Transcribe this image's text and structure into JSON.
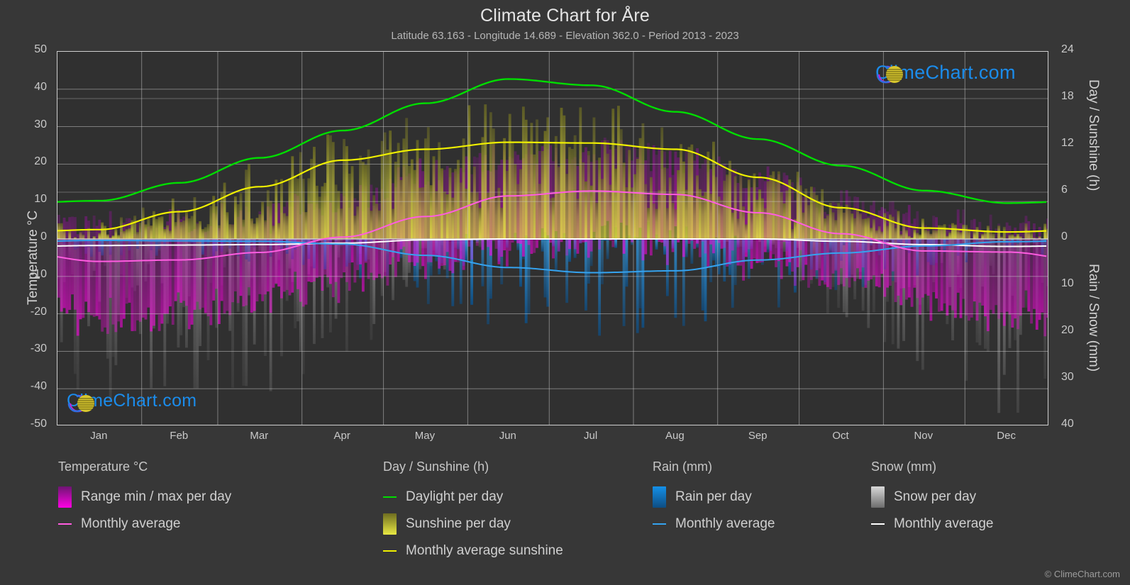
{
  "header": {
    "title": "Climate Chart for Åre",
    "subtitle": "Latitude 63.163 - Longitude 14.689 - Elevation 362.0 - Period 2013 - 2023"
  },
  "watermark": {
    "text": "ClimeChart.com"
  },
  "footer": {
    "copyright": "© ClimeChart.com"
  },
  "legend": {
    "groups": [
      {
        "title": "Temperature °C",
        "items": [
          {
            "label": "Range min / max per day",
            "swatch": "gradient",
            "color": "#ff00e4"
          },
          {
            "label": "Monthly average",
            "swatch": "line",
            "color": "#ff5ce0"
          }
        ]
      },
      {
        "title": "Day / Sunshine (h)",
        "items": [
          {
            "label": "Daylight per day",
            "swatch": "line",
            "color": "#00dd00"
          },
          {
            "label": "Sunshine per day",
            "swatch": "gradient",
            "color": "#e8e843"
          },
          {
            "label": "Monthly average sunshine",
            "swatch": "line",
            "color": "#f0f000"
          }
        ]
      },
      {
        "title": "Rain (mm)",
        "items": [
          {
            "label": "Rain per day",
            "swatch": "gradient",
            "color": "#1490e8"
          },
          {
            "label": "Monthly average",
            "swatch": "line",
            "color": "#35a3ef"
          }
        ]
      },
      {
        "title": "Snow (mm)",
        "items": [
          {
            "label": "Snow per day",
            "swatch": "gradient",
            "color": "#d8d8d8"
          },
          {
            "label": "Monthly average",
            "swatch": "line",
            "color": "#ffffff"
          }
        ]
      }
    ]
  },
  "chart_data": {
    "type": "line",
    "title": "Climate Chart for Åre",
    "subtitle": "Latitude 63.163 - Longitude 14.689 - Elevation 362.0 - Period 2013 - 2023",
    "xlabel": "",
    "grid": true,
    "legend_position": "below",
    "x_tick_labels": [
      "Jan",
      "Feb",
      "Mar",
      "Apr",
      "May",
      "Jun",
      "Jul",
      "Aug",
      "Sep",
      "Oct",
      "Nov",
      "Dec"
    ],
    "axes": {
      "left": {
        "label": "Temperature °C",
        "ylim": [
          -50,
          50
        ],
        "ticks": [
          50,
          40,
          30,
          20,
          10,
          0,
          -10,
          -20,
          -30,
          -40,
          -50
        ]
      },
      "right_top": {
        "label": "Day / Sunshine (h)",
        "ylim": [
          0,
          24
        ],
        "ticks": [
          24,
          18,
          12,
          6,
          0
        ],
        "note": "maps to temperature 0..50 above the zero line"
      },
      "right_bottom": {
        "label": "Rain / Snow (mm)",
        "ylim": [
          0,
          40
        ],
        "ticks": [
          0,
          10,
          20,
          30,
          40
        ],
        "note": "maps to temperature 0..-50 below the zero line"
      }
    },
    "series": [
      {
        "name": "Daylight per day",
        "unit": "h",
        "color": "#00dd00",
        "axis": "right_top",
        "categories": [
          "Jan",
          "Feb",
          "Mar",
          "Apr",
          "May",
          "Jun",
          "Jul",
          "Aug",
          "Sep",
          "Oct",
          "Nov",
          "Dec"
        ],
        "values": [
          4.9,
          7.2,
          10.4,
          13.9,
          17.4,
          20.5,
          19.7,
          16.3,
          12.8,
          9.4,
          6.2,
          4.6
        ]
      },
      {
        "name": "Monthly average sunshine",
        "unit": "h",
        "color": "#f0f000",
        "axis": "right_top",
        "categories": [
          "Jan",
          "Feb",
          "Mar",
          "Apr",
          "May",
          "Jun",
          "Jul",
          "Aug",
          "Sep",
          "Oct",
          "Nov",
          "Dec"
        ],
        "values": [
          1.2,
          3.5,
          6.7,
          10.1,
          11.5,
          12.4,
          12.3,
          11.5,
          7.9,
          4.0,
          1.4,
          0.9
        ]
      },
      {
        "name": "Temperature monthly average",
        "unit": "°C",
        "color": "#ff5ce0",
        "axis": "left",
        "categories": [
          "Jan",
          "Feb",
          "Mar",
          "Apr",
          "May",
          "Jun",
          "Jul",
          "Aug",
          "Sep",
          "Oct",
          "Nov",
          "Dec"
        ],
        "values": [
          -6.0,
          -5.6,
          -3.6,
          0.5,
          6.0,
          11.5,
          12.8,
          11.9,
          7.0,
          1.4,
          -3.2,
          -3.5
        ]
      },
      {
        "name": "Rain monthly average",
        "unit": "mm",
        "color": "#35a3ef",
        "axis": "right_bottom",
        "categories": [
          "Jan",
          "Feb",
          "Mar",
          "Apr",
          "May",
          "Jun",
          "Jul",
          "Aug",
          "Sep",
          "Oct",
          "Nov",
          "Dec"
        ],
        "values": [
          0.3,
          0.4,
          0.5,
          1.1,
          3.5,
          6.1,
          7.2,
          6.8,
          4.5,
          3.0,
          1.5,
          0.6
        ]
      },
      {
        "name": "Snow monthly average",
        "unit": "mm",
        "color": "#ffffff",
        "axis": "right_bottom",
        "categories": [
          "Jan",
          "Feb",
          "Mar",
          "Apr",
          "May",
          "Jun",
          "Jul",
          "Aug",
          "Sep",
          "Oct",
          "Nov",
          "Dec"
        ],
        "values": [
          1.4,
          1.3,
          1.2,
          0.9,
          0.2,
          0.0,
          0.0,
          0.0,
          0.0,
          0.5,
          1.2,
          1.6
        ]
      },
      {
        "name": "Temperature range min / max per day",
        "unit": "°C",
        "color": "#ff00e4",
        "axis": "left",
        "categories": [
          "Jan",
          "Feb",
          "Mar",
          "Apr",
          "May",
          "Jun",
          "Jul",
          "Aug",
          "Sep",
          "Oct",
          "Nov",
          "Dec"
        ],
        "max_values": [
          2.0,
          2.5,
          4.5,
          9.0,
          16.0,
          21.0,
          22.0,
          20.0,
          15.0,
          8.0,
          3.0,
          2.0
        ],
        "min_values": [
          -18.0,
          -17.0,
          -14.0,
          -8.0,
          -3.0,
          1.0,
          3.0,
          2.0,
          -2.0,
          -8.0,
          -14.0,
          -16.0
        ]
      },
      {
        "name": "Sunshine per day",
        "unit": "h",
        "color": "#e8e843",
        "axis": "right_top",
        "categories": [
          "Jan",
          "Feb",
          "Mar",
          "Apr",
          "May",
          "Jun",
          "Jul",
          "Aug",
          "Sep",
          "Oct",
          "Nov",
          "Dec"
        ],
        "max_values": [
          2.6,
          6.0,
          10.0,
          14.0,
          16.5,
          18.0,
          17.8,
          15.0,
          11.0,
          6.5,
          3.0,
          2.0
        ]
      },
      {
        "name": "Rain per day",
        "unit": "mm",
        "color": "#1490e8",
        "axis": "right_bottom",
        "categories": [
          "Jan",
          "Feb",
          "Mar",
          "Apr",
          "May",
          "Jun",
          "Jul",
          "Aug",
          "Sep",
          "Oct",
          "Nov",
          "Dec"
        ],
        "max_values": [
          4.0,
          4.0,
          5.0,
          8.0,
          14.0,
          20.0,
          22.0,
          20.0,
          16.0,
          12.0,
          8.0,
          5.0
        ]
      },
      {
        "name": "Snow per day",
        "unit": "mm",
        "color": "#d8d8d8",
        "axis": "right_bottom",
        "categories": [
          "Jan",
          "Feb",
          "Mar",
          "Apr",
          "May",
          "Jun",
          "Jul",
          "Aug",
          "Sep",
          "Oct",
          "Nov",
          "Dec"
        ],
        "max_values": [
          36.0,
          34.0,
          33.0,
          26.0,
          8.0,
          0.0,
          0.0,
          0.0,
          2.0,
          18.0,
          30.0,
          38.0
        ]
      }
    ]
  }
}
